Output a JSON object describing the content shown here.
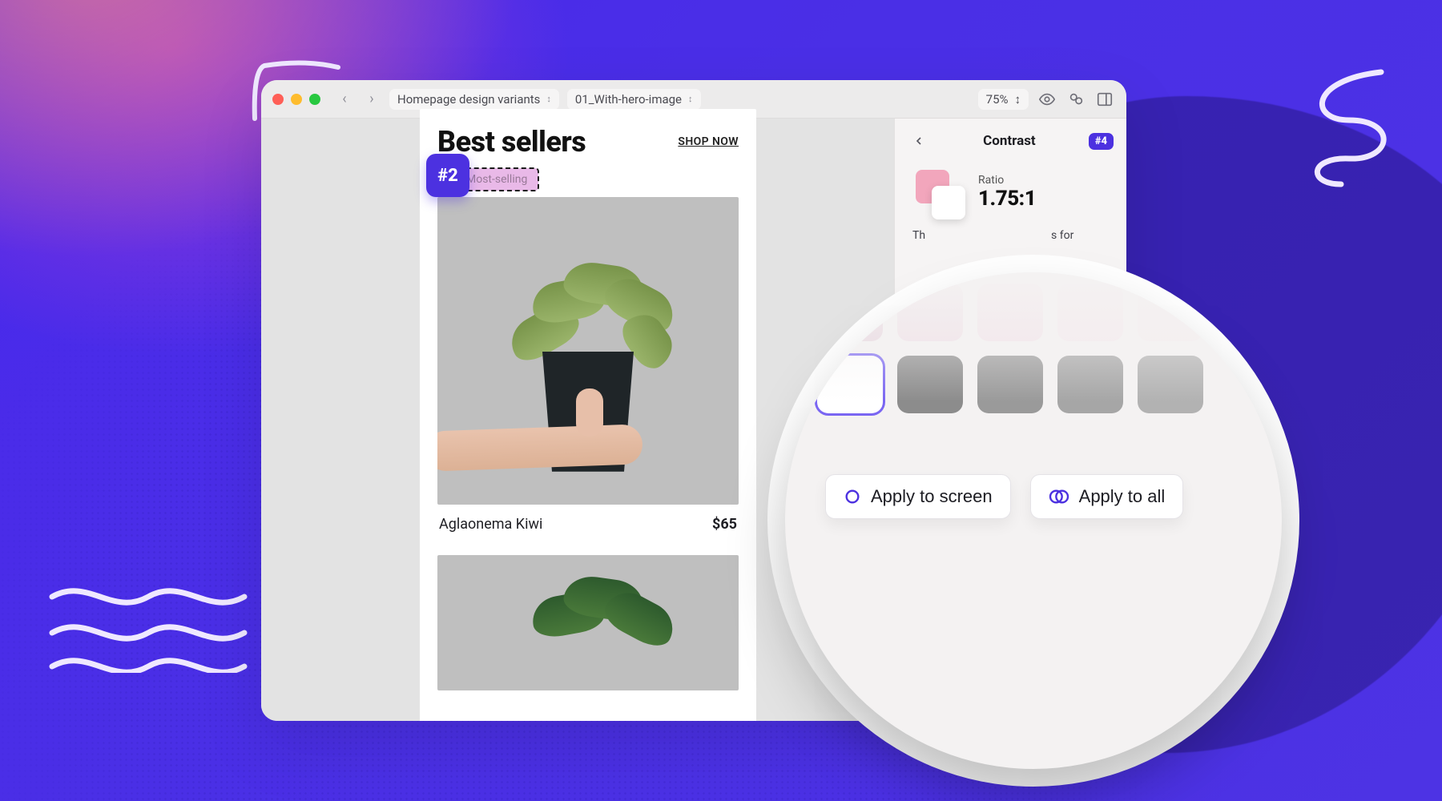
{
  "toolbar": {
    "breadcrumb_project": "Homepage design variants",
    "breadcrumb_artboard": "01_With-hero-image",
    "zoom": "75%"
  },
  "canvas": {
    "marker": "#2",
    "selection_label": "Most-selling",
    "section_title": "Best sellers",
    "shop_now": "SHOP NOW",
    "product": {
      "name": "Aglaonema Kiwi",
      "price": "$65"
    }
  },
  "panel": {
    "title": "Contrast",
    "badge": "#4",
    "ratio_label": "Ratio",
    "ratio_value": "1.75:1",
    "hint_prefix": "Th",
    "hint_suffix": "s for",
    "swatch_fg": "#F2A6BC",
    "swatch_bg": "#FFFFFF"
  },
  "magnifier": {
    "apply_screen": "Apply to screen",
    "apply_all": "Apply to all"
  }
}
